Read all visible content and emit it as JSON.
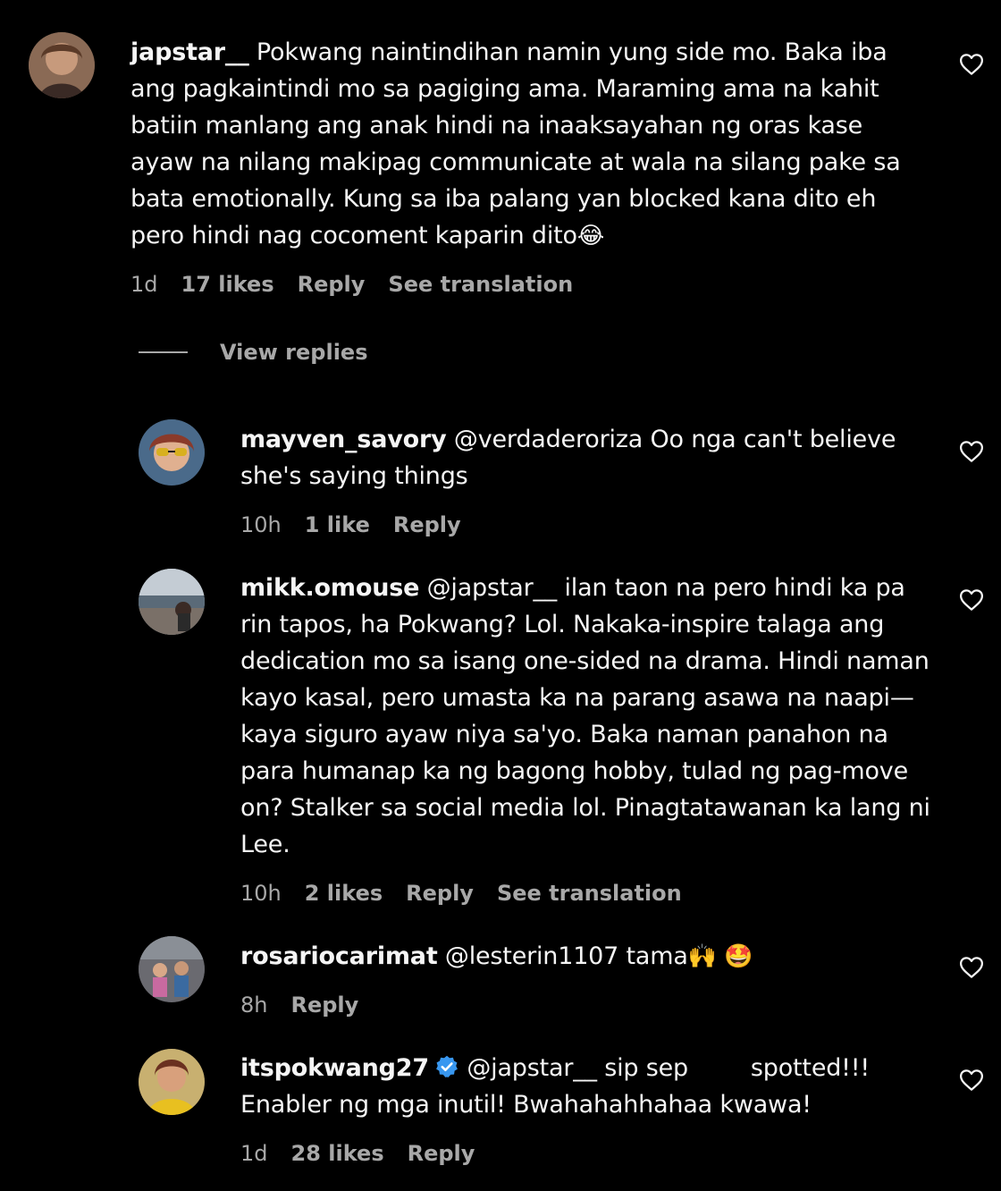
{
  "comments": [
    {
      "username": "japstar__",
      "text": "Pokwang naintindihan namin yung side mo. Baka iba ang pagkaintindi mo sa pagiging ama. Maraming ama na kahit batiin manlang ang anak hindi na inaaksayahan ng oras kase ayaw na nilang makipag communicate at wala na silang pake sa bata emotionally. Kung sa iba palang yan blocked kana dito eh pero hindi nag cocoment kaparin dito",
      "emoji": "😂",
      "time": "1d",
      "likes": "17 likes",
      "reply_label": "Reply",
      "translation_label": "See translation"
    }
  ],
  "view_replies_label": "View replies",
  "replies": [
    {
      "username": "mayven_savory",
      "text": "@verdaderoriza Oo nga can't believe she's saying things",
      "time": "10h",
      "likes": "1 like",
      "reply_label": "Reply"
    },
    {
      "username": "mikk.omouse",
      "text": "@japstar__ ilan taon na pero hindi ka pa rin tapos, ha Pokwang? Lol. Nakaka-inspire talaga ang dedication mo sa isang one-sided na drama. Hindi naman kayo kasal, pero umasta ka na parang asawa na naapi—kaya siguro ayaw niya sa'yo. Baka naman panahon na para humanap ka ng bagong hobby, tulad ng pag-move on? Stalker sa social media lol. Pinagtatawanan ka lang ni Lee.",
      "time": "10h",
      "likes": "2 likes",
      "reply_label": "Reply",
      "translation_label": "See translation"
    },
    {
      "username": "rosariocarimat",
      "text": "@lesterin1107 tama",
      "emoji": "🙌 🤩",
      "time": "8h",
      "reply_label": "Reply"
    },
    {
      "username": "itspokwang27",
      "text_part1": "@japstar__ sip sep",
      "text_part2": "spotted!!!",
      "text_line2": "Enabler ng mga inutil! Bwahahahhahaa kwawa!",
      "time": "1d",
      "likes": "28 likes",
      "reply_label": "Reply"
    }
  ],
  "colors": {
    "background": "#000000",
    "text": "#f5f5f5",
    "secondary": "#a8a8a8",
    "verified": "#3897f0"
  },
  "icons": {
    "like": "heart-outline-icon",
    "verified": "verified-badge-icon"
  }
}
